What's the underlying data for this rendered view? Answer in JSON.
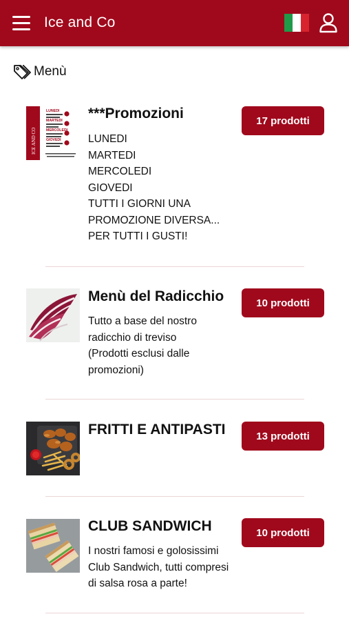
{
  "header": {
    "title": "Ice and Co",
    "menu_icon": "hamburger-menu-icon",
    "language_icon": "italian-flag-icon",
    "user_icon": "user-icon",
    "bg_color": "#a0091c"
  },
  "section": {
    "label": "Menù",
    "icon": "tag-icon"
  },
  "categories": [
    {
      "title": "***Promozioni",
      "count_label": "17 prodotti",
      "description": "LUNEDI\nMARTEDI\nMERCOLEDI\nGIOVEDI\nTUTTI I GIORNI UNA PROMOZIONE DIVERSA...\nPER TUTTI I GUSTI!",
      "image": {
        "side_text": "ICE AND CO",
        "days": [
          "LUNEDI",
          "MARTEDI",
          "MERCOLEDI",
          "GIOVEDI"
        ]
      }
    },
    {
      "title": "Menù del Radicchio",
      "count_label": "10 prodotti",
      "description": "Tutto a base del nostro radicchio di treviso (Prodotti esclusi dalle promozioni)"
    },
    {
      "title": "FRITTI E ANTIPASTI",
      "count_label": "13 prodotti",
      "description": ""
    },
    {
      "title": "CLUB SANDWICH",
      "count_label": "10 prodotti",
      "description": "I nostri famosi e golosissimi Club Sandwich, tutti compresi di salsa rosa a parte!"
    }
  ]
}
